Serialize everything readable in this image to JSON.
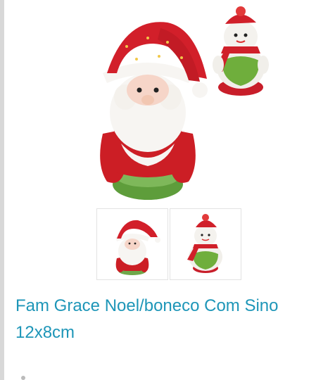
{
  "product": {
    "title": "Fam Grace Noel/boneco Com Sino 12x8cm"
  },
  "colors": {
    "title": "#1e96b8",
    "santa_red": "#d0202a",
    "snow_white": "#f4f2ee",
    "bell_green": "#6fa84a"
  },
  "icons": {
    "main": "santa-and-snowman-image",
    "thumb_1": "santa-thumbnail",
    "thumb_2": "snowman-thumbnail"
  }
}
